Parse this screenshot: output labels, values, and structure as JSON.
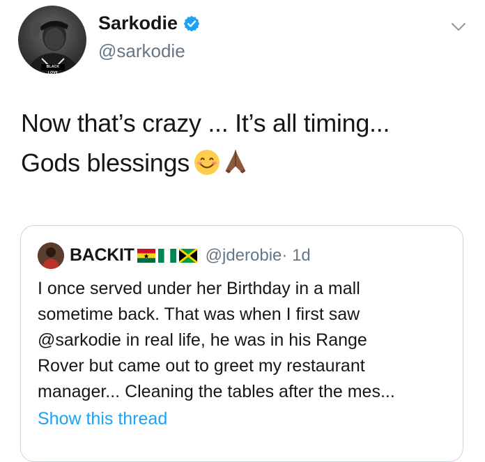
{
  "tweet": {
    "author": {
      "name": "Sarkodie",
      "handle": "@sarkodie",
      "verified": true,
      "avatar_caption": "BLACK LOVE"
    },
    "text_lines": [
      "Now that’s crazy ... It’s all timing...",
      "Gods blessings"
    ],
    "emojis": [
      "smiling-face-icon",
      "folded-hands-icon"
    ],
    "menu_icon": "chevron-down-icon"
  },
  "quote": {
    "name": "BACKIT",
    "flags": [
      "ghana-flag-icon",
      "nigeria-flag-icon",
      "jamaica-flag-icon"
    ],
    "handle": "@jderobie",
    "time": " · 1d",
    "text_lines": [
      "I once served under her Birthday in a mall",
      "sometime back. That was when I first saw",
      "@sarkodie  in real life, he was in his Range",
      "Rover but came out to greet my restaurant",
      "manager... Cleaning the tables after the mes..."
    ],
    "show_thread_label": "Show this thread"
  },
  "colors": {
    "text": "#14171a",
    "secondary": "#657786",
    "link": "#1da1f2",
    "border": "#ccd6dd",
    "verified": "#1da1f2"
  }
}
